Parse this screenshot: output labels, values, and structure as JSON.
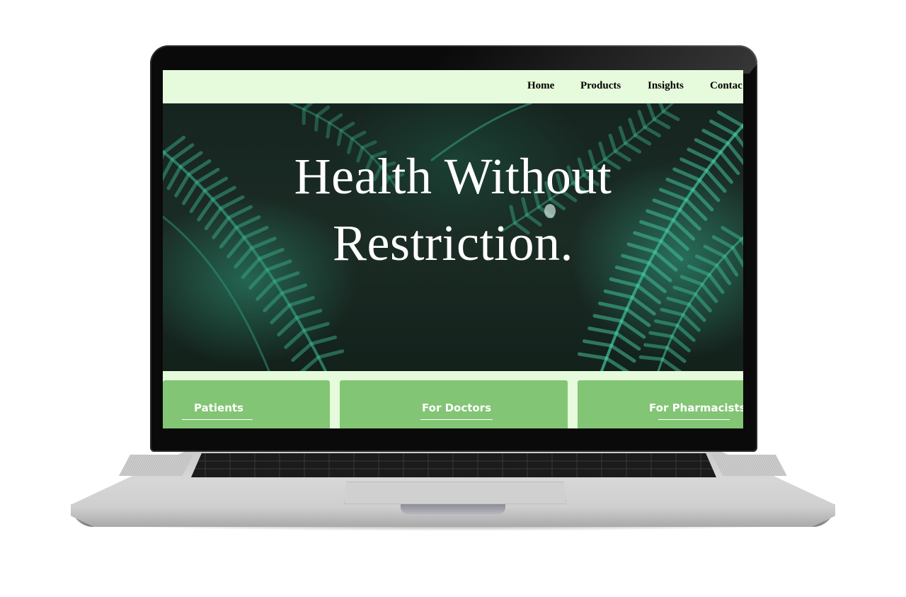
{
  "nav": {
    "items": [
      {
        "label": "Home"
      },
      {
        "label": "Products"
      },
      {
        "label": "Insights"
      },
      {
        "label": "Contac"
      }
    ]
  },
  "hero": {
    "title_line1": "Health Without",
    "title_line2": "Restriction."
  },
  "cards": [
    {
      "title": "Patients"
    },
    {
      "title": "For Doctors"
    },
    {
      "title": "For Pharmacists"
    }
  ],
  "colors": {
    "nav_bg": "#e6fbdc",
    "card_green": "#82c574",
    "hero_dark": "#16241f"
  }
}
